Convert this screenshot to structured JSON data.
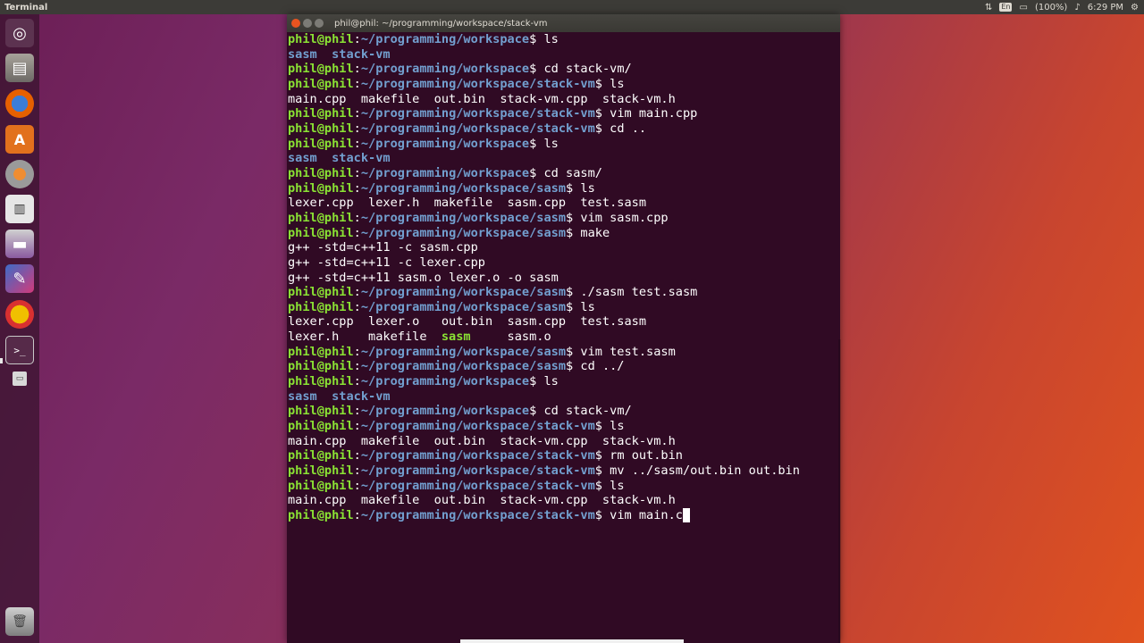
{
  "panel": {
    "app_title": "Terminal",
    "battery": "(100%)",
    "time": "6:29 PM",
    "keyboard_badge": "En",
    "icons": [
      "network-icon",
      "keyboard-icon",
      "battery-icon",
      "volume-icon",
      "time-icon",
      "power-gear-icon"
    ]
  },
  "launcher": {
    "items": [
      "dash-icon",
      "files-icon",
      "firefox-icon",
      "software-center-icon",
      "system-settings-icon",
      "office-icon",
      "video-icon",
      "drawing-icon",
      "bsd-icon",
      "terminal-icon",
      "window-icon",
      "trash-icon"
    ]
  },
  "window": {
    "title": "phil@phil: ~/programming/workspace/stack-vm"
  },
  "terminal": {
    "user": "phil@phil",
    "lines": [
      {
        "type": "cmd",
        "path": "~/programming/workspace",
        "cmd": " ls"
      },
      {
        "type": "out",
        "parts": [
          {
            "t": "sasm",
            "c": "d"
          },
          {
            "t": "  "
          },
          {
            "t": "stack-vm",
            "c": "d"
          }
        ]
      },
      {
        "type": "cmd",
        "path": "~/programming/workspace",
        "cmd": " cd stack-vm/"
      },
      {
        "type": "cmd",
        "path": "~/programming/workspace/stack-vm",
        "cmd": " ls"
      },
      {
        "type": "out",
        "parts": [
          {
            "t": "main.cpp  makefile  out.bin  stack-vm.cpp  stack-vm.h"
          }
        ]
      },
      {
        "type": "cmd",
        "path": "~/programming/workspace/stack-vm",
        "cmd": " vim main.cpp"
      },
      {
        "type": "cmd",
        "path": "~/programming/workspace/stack-vm",
        "cmd": " cd .."
      },
      {
        "type": "cmd",
        "path": "~/programming/workspace",
        "cmd": " ls"
      },
      {
        "type": "out",
        "parts": [
          {
            "t": "sasm",
            "c": "d"
          },
          {
            "t": "  "
          },
          {
            "t": "stack-vm",
            "c": "d"
          }
        ]
      },
      {
        "type": "cmd",
        "path": "~/programming/workspace",
        "cmd": " cd sasm/"
      },
      {
        "type": "cmd",
        "path": "~/programming/workspace/sasm",
        "cmd": " ls"
      },
      {
        "type": "out",
        "parts": [
          {
            "t": "lexer.cpp  lexer.h  makefile  sasm.cpp  test.sasm"
          }
        ]
      },
      {
        "type": "cmd",
        "path": "~/programming/workspace/sasm",
        "cmd": " vim sasm.cpp"
      },
      {
        "type": "cmd",
        "path": "~/programming/workspace/sasm",
        "cmd": " make"
      },
      {
        "type": "out",
        "parts": [
          {
            "t": "g++ -std=c++11 -c sasm.cpp"
          }
        ]
      },
      {
        "type": "out",
        "parts": [
          {
            "t": "g++ -std=c++11 -c lexer.cpp"
          }
        ]
      },
      {
        "type": "out",
        "parts": [
          {
            "t": "g++ -std=c++11 sasm.o lexer.o -o sasm"
          }
        ]
      },
      {
        "type": "cmd",
        "path": "~/programming/workspace/sasm",
        "cmd": " ./sasm test.sasm"
      },
      {
        "type": "cmd",
        "path": "~/programming/workspace/sasm",
        "cmd": " ls"
      },
      {
        "type": "out",
        "parts": [
          {
            "t": "lexer.cpp  lexer.o   out.bin  sasm.cpp  test.sasm"
          }
        ]
      },
      {
        "type": "out",
        "parts": [
          {
            "t": "lexer.h    makefile  "
          },
          {
            "t": "sasm",
            "c": "x"
          },
          {
            "t": "     sasm.o"
          }
        ]
      },
      {
        "type": "cmd",
        "path": "~/programming/workspace/sasm",
        "cmd": " vim test.sasm"
      },
      {
        "type": "cmd",
        "path": "~/programming/workspace/sasm",
        "cmd": " cd ../"
      },
      {
        "type": "cmd",
        "path": "~/programming/workspace",
        "cmd": " ls"
      },
      {
        "type": "out",
        "parts": [
          {
            "t": "sasm",
            "c": "d"
          },
          {
            "t": "  "
          },
          {
            "t": "stack-vm",
            "c": "d"
          }
        ]
      },
      {
        "type": "cmd",
        "path": "~/programming/workspace",
        "cmd": " cd stack-vm/"
      },
      {
        "type": "cmd",
        "path": "~/programming/workspace/stack-vm",
        "cmd": " ls"
      },
      {
        "type": "out",
        "parts": [
          {
            "t": "main.cpp  makefile  out.bin  stack-vm.cpp  stack-vm.h"
          }
        ]
      },
      {
        "type": "cmd",
        "path": "~/programming/workspace/stack-vm",
        "cmd": " rm out.bin"
      },
      {
        "type": "cmd",
        "path": "~/programming/workspace/stack-vm",
        "cmd": " mv ../sasm/out.bin out.bin"
      },
      {
        "type": "cmd",
        "path": "~/programming/workspace/stack-vm",
        "cmd": " ls"
      },
      {
        "type": "out",
        "parts": [
          {
            "t": "main.cpp  makefile  out.bin  stack-vm.cpp  stack-vm.h"
          }
        ]
      },
      {
        "type": "cmd",
        "path": "~/programming/workspace/stack-vm",
        "cmd": " vim main.c",
        "cursor": true
      }
    ]
  },
  "colors": {
    "terminal_bg": "#300a24",
    "user_green": "#8ae234",
    "path_blue": "#729fcf",
    "accent_orange": "#e95420"
  }
}
